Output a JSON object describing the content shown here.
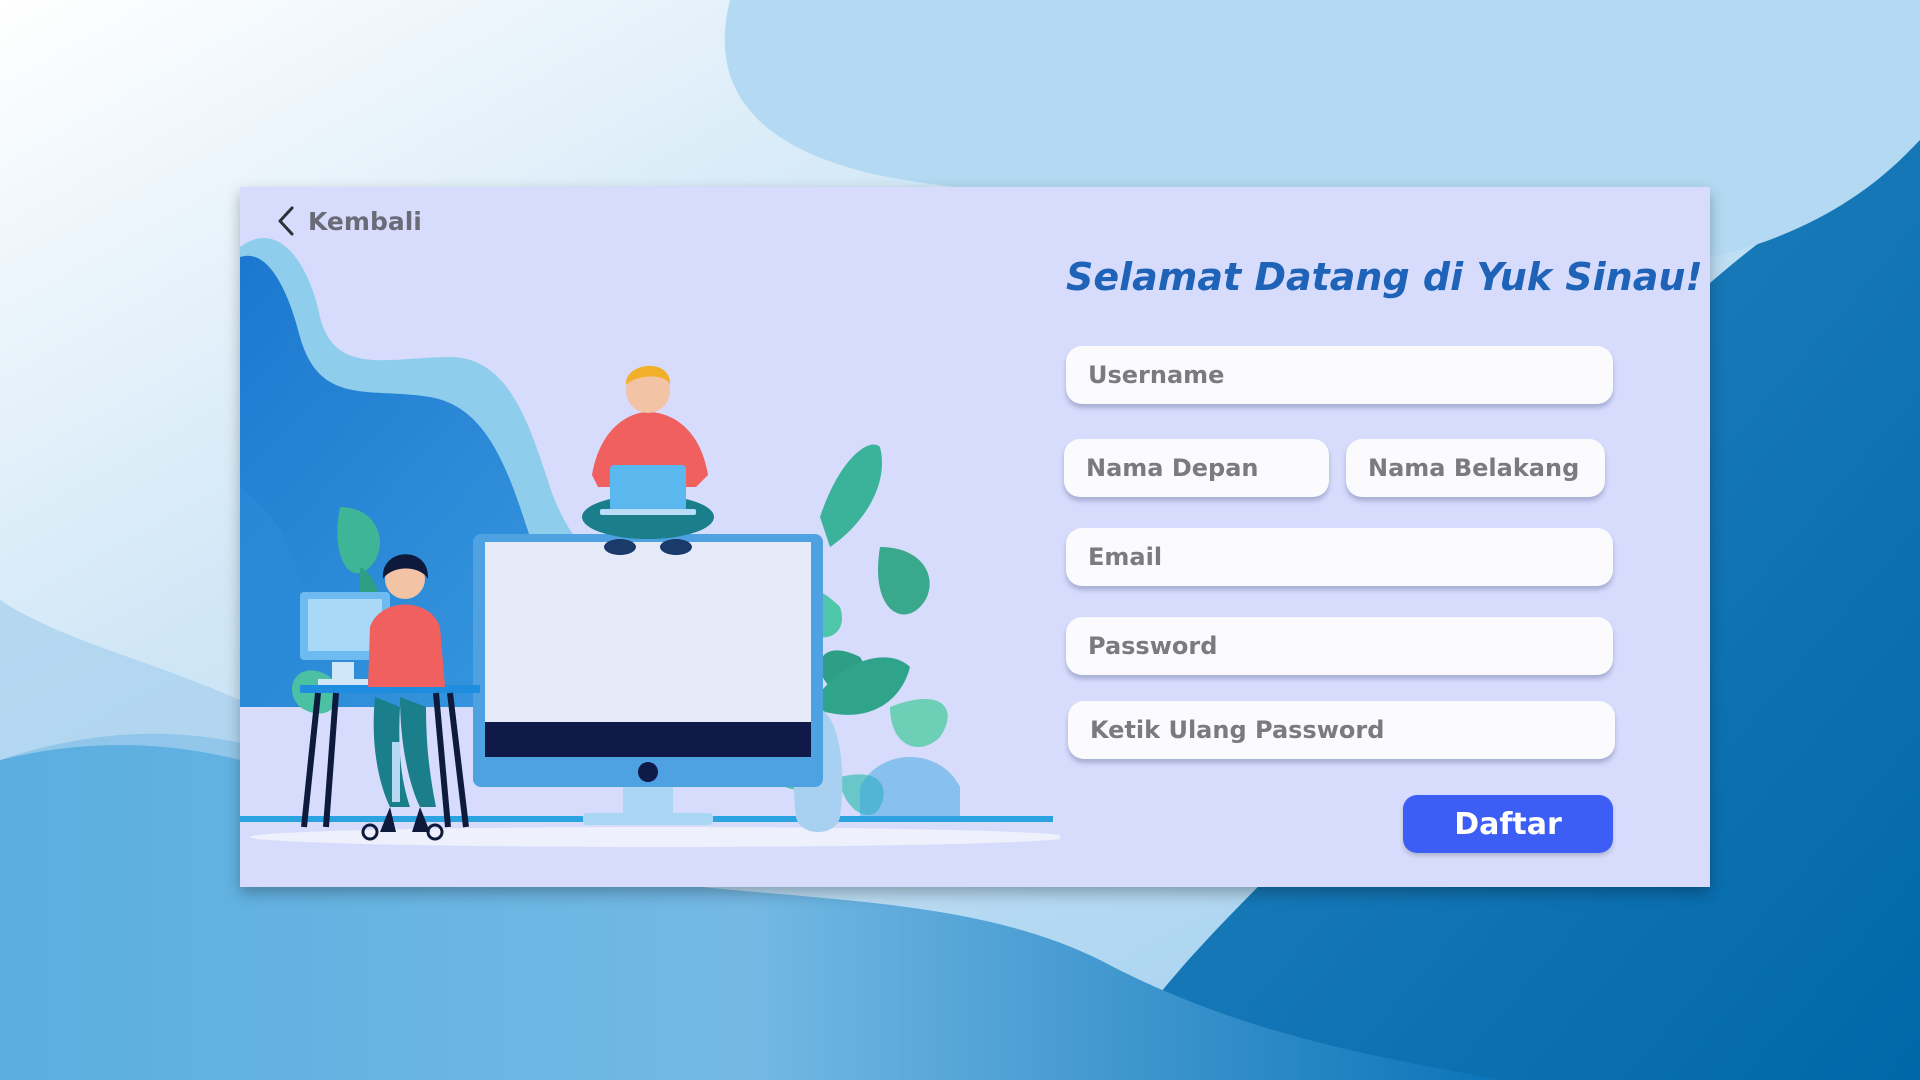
{
  "header": {
    "back_label": "Kembali",
    "title": "Selamat Datang di Yuk Sinau!"
  },
  "form": {
    "username_placeholder": "Username",
    "first_name_placeholder": "Nama Depan",
    "last_name_placeholder": "Nama Belakang",
    "email_placeholder": "Email",
    "password_placeholder": "Password",
    "confirm_password_placeholder": "Ketik Ulang Password",
    "submit_label": "Daftar"
  },
  "icons": {
    "back": "chevron-left-icon"
  },
  "colors": {
    "card_background": "#d7dcfd",
    "title": "#1e63b8",
    "submit_button": "#3d5ef5",
    "input_background": "#fbfbfd"
  }
}
